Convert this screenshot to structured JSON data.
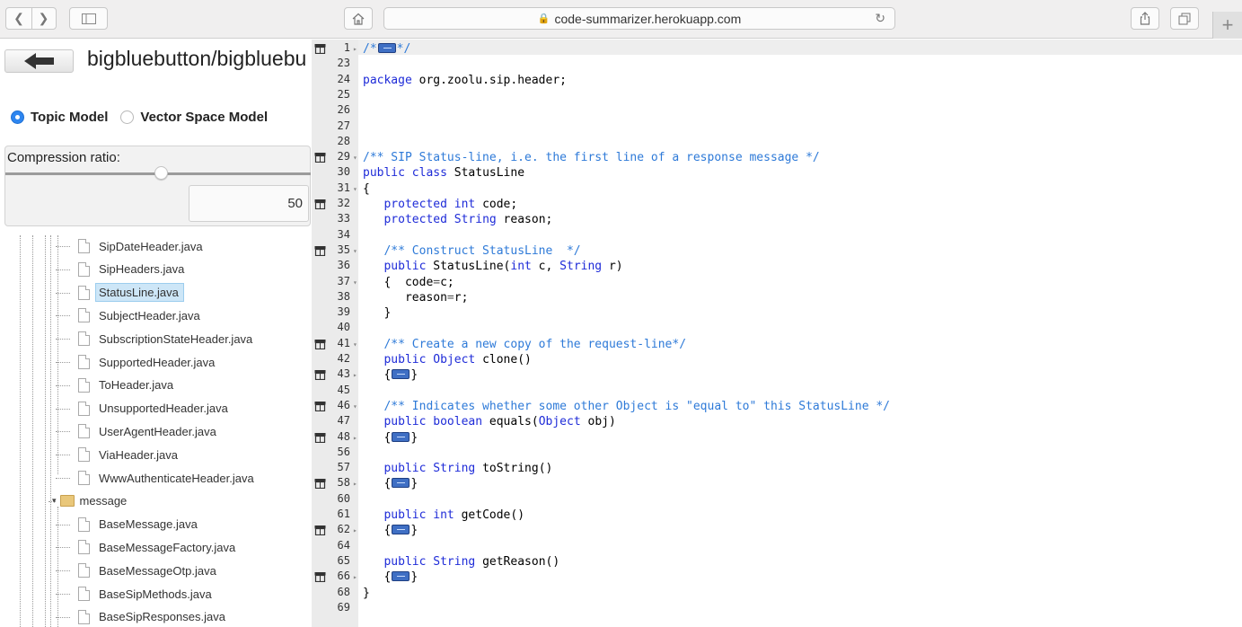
{
  "browser": {
    "url": "code-summarizer.herokuapp.com"
  },
  "app": {
    "repo_title": "bigbluebutton/bigbluebu",
    "models": [
      {
        "label": "Topic Model",
        "selected": true
      },
      {
        "label": "Vector Space Model",
        "selected": false
      }
    ],
    "compression": {
      "label": "Compression ratio:",
      "value": "50",
      "slider_fraction": 0.5
    }
  },
  "tree": {
    "items": [
      {
        "label": "SipDateHeader.java",
        "type": "file",
        "selected": false
      },
      {
        "label": "SipHeaders.java",
        "type": "file",
        "selected": false
      },
      {
        "label": "StatusLine.java",
        "type": "file",
        "selected": true
      },
      {
        "label": "SubjectHeader.java",
        "type": "file",
        "selected": false
      },
      {
        "label": "SubscriptionStateHeader.java",
        "type": "file",
        "selected": false
      },
      {
        "label": "SupportedHeader.java",
        "type": "file",
        "selected": false
      },
      {
        "label": "ToHeader.java",
        "type": "file",
        "selected": false
      },
      {
        "label": "UnsupportedHeader.java",
        "type": "file",
        "selected": false
      },
      {
        "label": "UserAgentHeader.java",
        "type": "file",
        "selected": false
      },
      {
        "label": "ViaHeader.java",
        "type": "file",
        "selected": false
      },
      {
        "label": "WwwAuthenticateHeader.java",
        "type": "file",
        "selected": false
      },
      {
        "label": "message",
        "type": "folder",
        "selected": false
      },
      {
        "label": "BaseMessage.java",
        "type": "file",
        "selected": false
      },
      {
        "label": "BaseMessageFactory.java",
        "type": "file",
        "selected": false
      },
      {
        "label": "BaseMessageOtp.java",
        "type": "file",
        "selected": false
      },
      {
        "label": "BaseSipMethods.java",
        "type": "file",
        "selected": false
      },
      {
        "label": "BaseSipResponses.java",
        "type": "file",
        "selected": false
      }
    ]
  },
  "code": {
    "lines": [
      {
        "n": "1",
        "fold": true,
        "arrow": "▸",
        "tokens": [
          [
            "cm",
            "/*"
          ],
          [
            "badge",
            ""
          ],
          [
            "cm",
            "*/"
          ]
        ]
      },
      {
        "n": "23",
        "tokens": []
      },
      {
        "n": "24",
        "tokens": [
          [
            "kw",
            "package"
          ],
          [
            "pl",
            " org.zoolu.sip.header;"
          ]
        ]
      },
      {
        "n": "25",
        "tokens": []
      },
      {
        "n": "26",
        "tokens": []
      },
      {
        "n": "27",
        "tokens": []
      },
      {
        "n": "28",
        "tokens": []
      },
      {
        "n": "29",
        "fold": true,
        "arrow": "▾",
        "tokens": [
          [
            "cm",
            "/** SIP Status-line, i.e. the first line of a response message */"
          ]
        ]
      },
      {
        "n": "30",
        "tokens": [
          [
            "kw",
            "public"
          ],
          [
            "pl",
            " "
          ],
          [
            "kw",
            "class"
          ],
          [
            "pl",
            " StatusLine"
          ]
        ]
      },
      {
        "n": "31",
        "arrow": "▾",
        "tokens": [
          [
            "pl",
            "{"
          ]
        ]
      },
      {
        "n": "32",
        "fold": true,
        "tokens": [
          [
            "pl",
            "   "
          ],
          [
            "kw",
            "protected"
          ],
          [
            "pl",
            " "
          ],
          [
            "kw",
            "int"
          ],
          [
            "pl",
            " code;"
          ]
        ]
      },
      {
        "n": "33",
        "tokens": [
          [
            "pl",
            "   "
          ],
          [
            "kw",
            "protected"
          ],
          [
            "pl",
            " "
          ],
          [
            "kw",
            "String"
          ],
          [
            "pl",
            " reason;"
          ]
        ]
      },
      {
        "n": "34",
        "tokens": []
      },
      {
        "n": "35",
        "fold": true,
        "arrow": "▾",
        "tokens": [
          [
            "pl",
            "   "
          ],
          [
            "cm",
            "/** Construct StatusLine  */"
          ]
        ]
      },
      {
        "n": "36",
        "tokens": [
          [
            "pl",
            "   "
          ],
          [
            "kw",
            "public"
          ],
          [
            "pl",
            " StatusLine("
          ],
          [
            "kw",
            "int"
          ],
          [
            "pl",
            " c, "
          ],
          [
            "kw",
            "String"
          ],
          [
            "pl",
            " r)"
          ]
        ]
      },
      {
        "n": "37",
        "arrow": "▾",
        "tokens": [
          [
            "pl",
            "   {  code"
          ],
          [
            "op",
            "="
          ],
          [
            "pl",
            "c;"
          ]
        ]
      },
      {
        "n": "38",
        "tokens": [
          [
            "pl",
            "      reason"
          ],
          [
            "op",
            "="
          ],
          [
            "pl",
            "r;"
          ]
        ]
      },
      {
        "n": "39",
        "tokens": [
          [
            "pl",
            "   }"
          ]
        ]
      },
      {
        "n": "40",
        "tokens": []
      },
      {
        "n": "41",
        "fold": true,
        "arrow": "▾",
        "tokens": [
          [
            "pl",
            "   "
          ],
          [
            "cm",
            "/** Create a new copy of the request-line*/"
          ]
        ]
      },
      {
        "n": "42",
        "tokens": [
          [
            "pl",
            "   "
          ],
          [
            "kw",
            "public"
          ],
          [
            "pl",
            " "
          ],
          [
            "kw",
            "Object"
          ],
          [
            "pl",
            " clone()"
          ]
        ]
      },
      {
        "n": "43",
        "fold": true,
        "arrow": "▸",
        "tokens": [
          [
            "pl",
            "   {"
          ],
          [
            "badge",
            ""
          ],
          [
            "pl",
            "}"
          ]
        ]
      },
      {
        "n": "45",
        "tokens": []
      },
      {
        "n": "46",
        "fold": true,
        "arrow": "▾",
        "tokens": [
          [
            "pl",
            "   "
          ],
          [
            "cm",
            "/** Indicates whether some other Object is \"equal to\" this StatusLine */"
          ]
        ]
      },
      {
        "n": "47",
        "tokens": [
          [
            "pl",
            "   "
          ],
          [
            "kw",
            "public"
          ],
          [
            "pl",
            " "
          ],
          [
            "kw",
            "boolean"
          ],
          [
            "pl",
            " equals("
          ],
          [
            "kw",
            "Object"
          ],
          [
            "pl",
            " obj)"
          ]
        ]
      },
      {
        "n": "48",
        "fold": true,
        "arrow": "▸",
        "tokens": [
          [
            "pl",
            "   {"
          ],
          [
            "badge",
            ""
          ],
          [
            "pl",
            "}"
          ]
        ]
      },
      {
        "n": "56",
        "tokens": []
      },
      {
        "n": "57",
        "tokens": [
          [
            "pl",
            "   "
          ],
          [
            "kw",
            "public"
          ],
          [
            "pl",
            " "
          ],
          [
            "kw",
            "String"
          ],
          [
            "pl",
            " toString()"
          ]
        ]
      },
      {
        "n": "58",
        "fold": true,
        "arrow": "▸",
        "tokens": [
          [
            "pl",
            "   {"
          ],
          [
            "badge",
            ""
          ],
          [
            "pl",
            "}"
          ]
        ]
      },
      {
        "n": "60",
        "tokens": []
      },
      {
        "n": "61",
        "tokens": [
          [
            "pl",
            "   "
          ],
          [
            "kw",
            "public"
          ],
          [
            "pl",
            " "
          ],
          [
            "kw",
            "int"
          ],
          [
            "pl",
            " getCode()"
          ]
        ]
      },
      {
        "n": "62",
        "fold": true,
        "arrow": "▸",
        "tokens": [
          [
            "pl",
            "   {"
          ],
          [
            "badge",
            ""
          ],
          [
            "pl",
            "}"
          ]
        ]
      },
      {
        "n": "64",
        "tokens": []
      },
      {
        "n": "65",
        "tokens": [
          [
            "pl",
            "   "
          ],
          [
            "kw",
            "public"
          ],
          [
            "pl",
            " "
          ],
          [
            "kw",
            "String"
          ],
          [
            "pl",
            " getReason()"
          ]
        ]
      },
      {
        "n": "66",
        "fold": true,
        "arrow": "▸",
        "tokens": [
          [
            "pl",
            "   {"
          ],
          [
            "badge",
            ""
          ],
          [
            "pl",
            "}"
          ]
        ]
      },
      {
        "n": "68",
        "tokens": [
          [
            "pl",
            "}"
          ]
        ]
      },
      {
        "n": "69",
        "tokens": []
      }
    ]
  }
}
